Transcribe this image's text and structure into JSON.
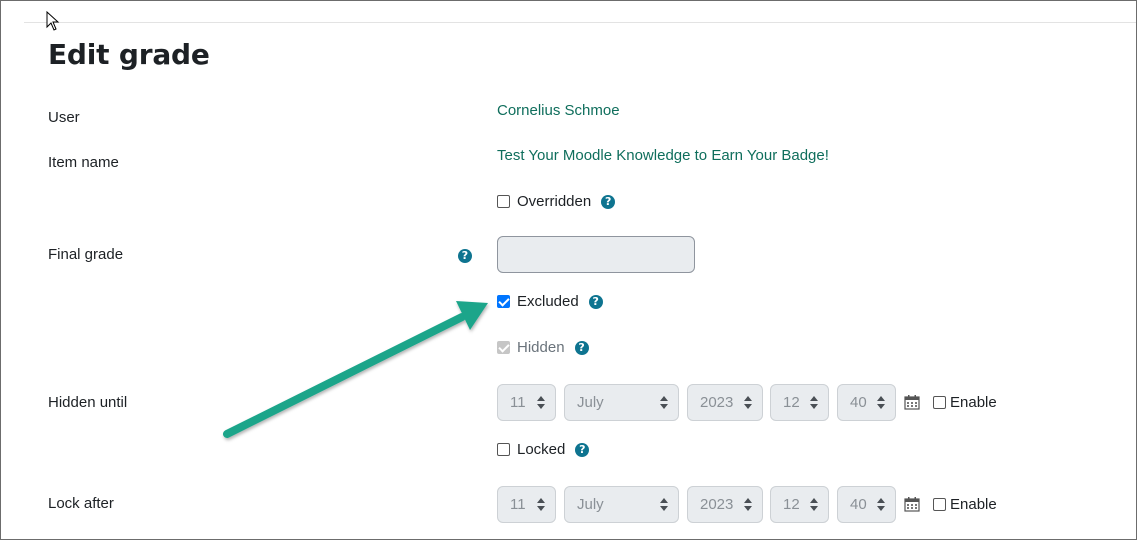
{
  "page": {
    "title": "Edit grade"
  },
  "labels": {
    "user": "User",
    "item_name": "Item name",
    "final_grade": "Final grade",
    "hidden_until": "Hidden until",
    "lock_after": "Lock after"
  },
  "user_link": "Cornelius Schmoe",
  "item_link": "Test Your Moodle Knowledge to Earn Your Badge!",
  "checkboxes": {
    "overridden": {
      "label": "Overridden",
      "checked": false
    },
    "excluded": {
      "label": "Excluded",
      "checked": true
    },
    "hidden": {
      "label": "Hidden",
      "checked": true,
      "disabled": true
    },
    "locked": {
      "label": "Locked",
      "checked": false
    }
  },
  "final_grade_value": "",
  "help_icon_glyph": "?",
  "hidden_until": {
    "day": "11",
    "month": "July",
    "year": "2023",
    "hour": "12",
    "minute": "40",
    "enable_label": "Enable"
  },
  "lock_after": {
    "day": "11",
    "month": "July",
    "year": "2023",
    "hour": "12",
    "minute": "40",
    "enable_label": "Enable"
  },
  "colors": {
    "link": "#0f6e5c",
    "help_icon": "#0e7490",
    "annotation_arrow": "#1aa58a",
    "checkbox_checked": "#0075ff"
  }
}
